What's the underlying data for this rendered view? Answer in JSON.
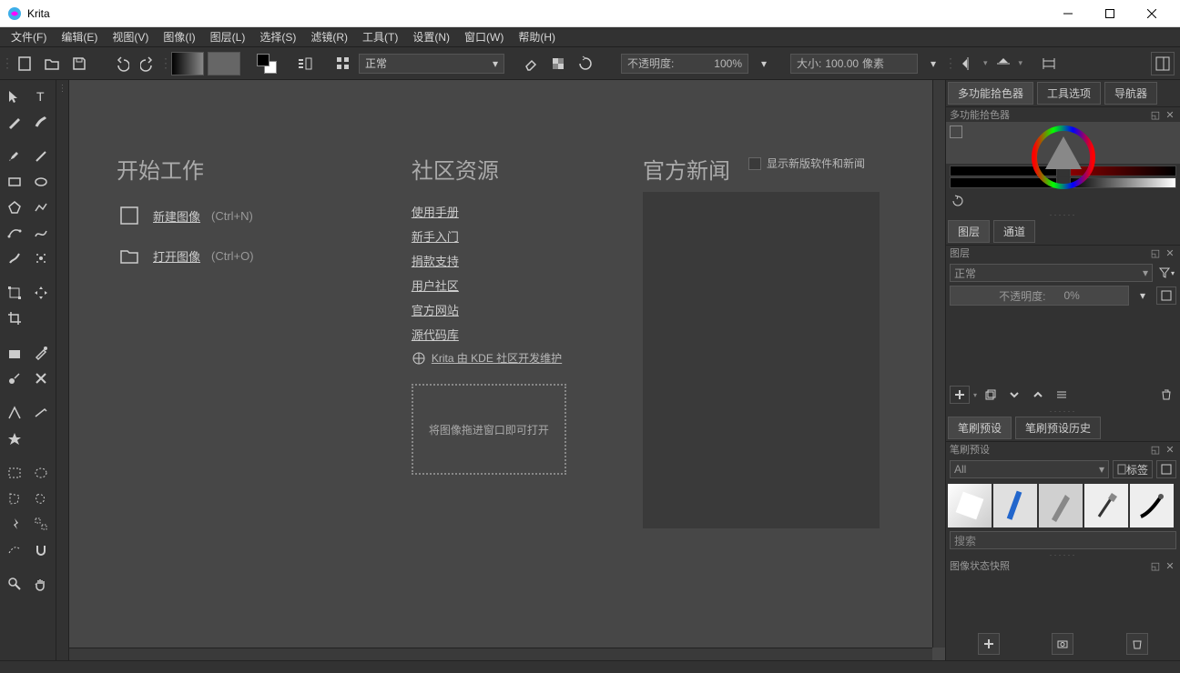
{
  "app": {
    "title": "Krita"
  },
  "menu": [
    "文件(F)",
    "编辑(E)",
    "视图(V)",
    "图像(I)",
    "图层(L)",
    "选择(S)",
    "滤镜(R)",
    "工具(T)",
    "设置(N)",
    "窗口(W)",
    "帮助(H)"
  ],
  "toolbar": {
    "blend_mode": "正常",
    "opacity_label": "不透明度:",
    "opacity_value": "100%",
    "size_label": "大小:",
    "size_value": "100.00",
    "size_unit": "像素"
  },
  "start": {
    "work_title": "开始工作",
    "new_image": "新建图像",
    "new_shortcut": "(Ctrl+N)",
    "open_image": "打开图像",
    "open_shortcut": "(Ctrl+O)",
    "res_title": "社区资源",
    "res_links": [
      "使用手册",
      "新手入门",
      "捐款支持",
      "用户社区",
      "官方网站",
      "源代码库"
    ],
    "kde_line": "Krita 由 KDE 社区开发维护",
    "dropzone": "将图像拖进窗口即可打开",
    "news_title": "官方新闻",
    "news_check": "显示新版软件和新闻"
  },
  "panels": {
    "tabs1": [
      "多功能拾色器",
      "工具选项",
      "导航器"
    ],
    "tabs1_header": "多功能拾色器",
    "tabs2": [
      "图层",
      "通道"
    ],
    "tabs2_header": "图层",
    "layer_mode": "正常",
    "layer_opacity_label": "不透明度:",
    "layer_opacity_value": "0%",
    "tabs3": [
      "笔刷预设",
      "笔刷预设历史"
    ],
    "tabs3_header": "笔刷预设",
    "brush_filter": "All",
    "brush_tag": "标签",
    "brush_search": "搜索",
    "snapshot_header": "图像状态快照"
  }
}
